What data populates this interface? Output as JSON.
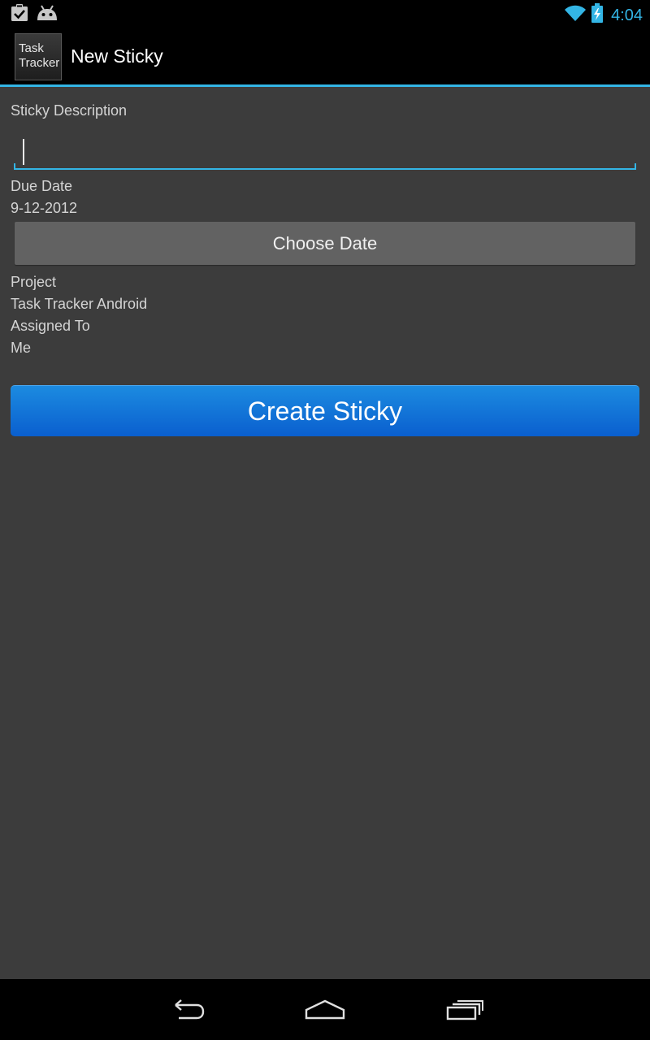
{
  "status_bar": {
    "time": "4:04",
    "accent_color": "#33b5e5",
    "icons": [
      "clipboard-check-icon",
      "android-icon",
      "wifi-icon",
      "battery-charging-icon"
    ]
  },
  "action_bar": {
    "logo_line1": "Task",
    "logo_line2": "Tracker",
    "title": "New Sticky"
  },
  "form": {
    "description_label": "Sticky Description",
    "description_value": "",
    "due_date_label": "Due Date",
    "due_date_value": "9-12-2012",
    "choose_date_label": "Choose Date",
    "project_label": "Project",
    "project_value": "Task Tracker Android",
    "assigned_label": "Assigned To",
    "assigned_value": "Me",
    "create_label": "Create Sticky"
  },
  "nav_bar": {
    "icons": [
      "back-icon",
      "home-icon",
      "recent-apps-icon"
    ]
  },
  "colors": {
    "background": "#3c3c3c",
    "accent": "#33b5e5",
    "primary_button": "#0a6fd8"
  }
}
